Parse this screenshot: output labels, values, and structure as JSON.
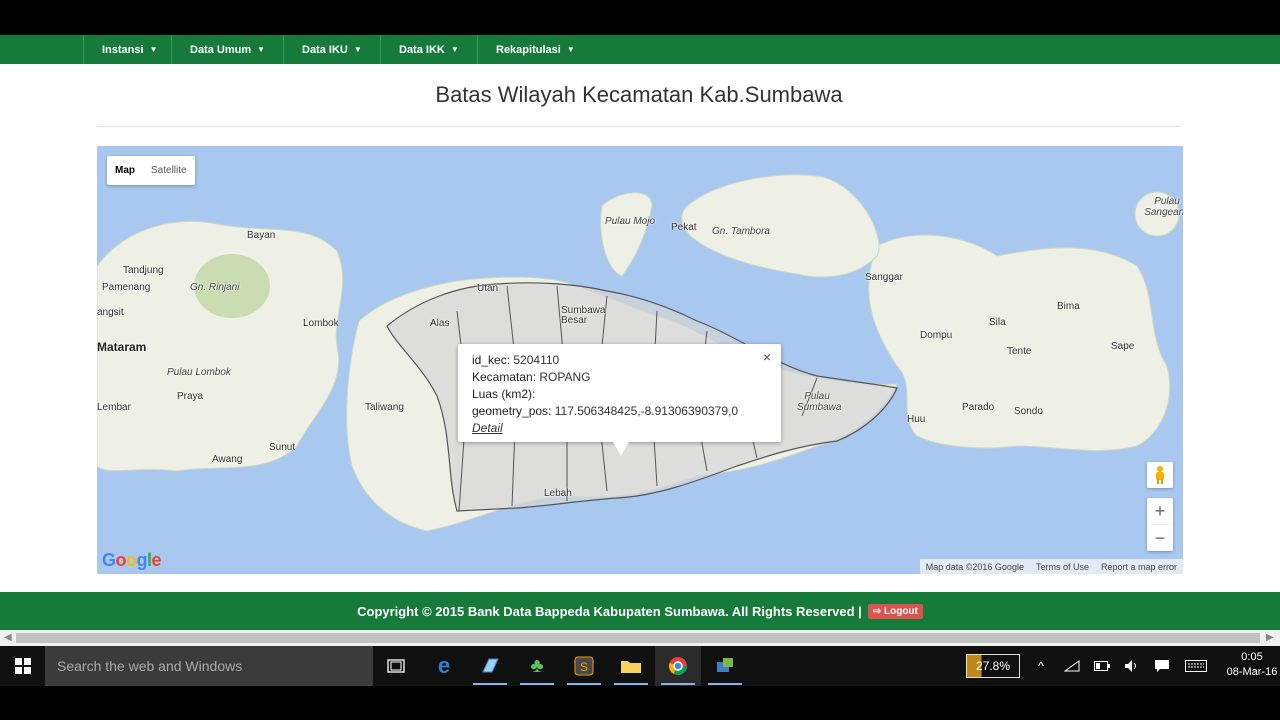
{
  "nav": {
    "items": [
      {
        "label": "Instansi"
      },
      {
        "label": "Data Umum"
      },
      {
        "label": "Data IKU"
      },
      {
        "label": "Data IKK"
      },
      {
        "label": "Rekapitulasi"
      }
    ]
  },
  "page": {
    "title": "Batas Wilayah Kecamatan Kab.Sumbawa"
  },
  "map": {
    "type_controls": {
      "map": "Map",
      "satellite": "Satellite"
    },
    "labels": {
      "bayan": "Bayan",
      "tandjung": "Tandjung",
      "pamenang": "Pamenang",
      "gn_rinjani": "Gn. Rinjani",
      "angsit": "angsit",
      "lombok": "Lombok",
      "mataram": "Mataram",
      "pulau_lombok": "Pulau Lombok",
      "praya": "Praya",
      "lembar": "Lembar",
      "sunut": "Sunut",
      "awang": "Awang",
      "pulau_mojo": "Pulau Mojo",
      "pekat": "Pekat",
      "gn_tambora": "Gn. Tambora",
      "pulau_sangeang": "Pulau Sangeang",
      "utan": "Utan",
      "sumbawa_besar": "Sumbawa Besar",
      "alas": "Alas",
      "taliwang": "Taliwang",
      "lebah": "Lebah",
      "pulau_sumbawa": "Pulau Sumbawa",
      "sanggar": "Sanggar",
      "dompu": "Dompu",
      "sila": "Sila",
      "bima": "Bima",
      "tente": "Tente",
      "sape": "Sape",
      "huu": "Huu",
      "parado": "Parado",
      "sondo": "Sondo"
    },
    "popup": {
      "id_kec_label": "id_kec:",
      "id_kec_value": "5204110",
      "kecamatan_label": "Kecamatan:",
      "kecamatan_value": "ROPANG",
      "luas_label": "Luas (km2):",
      "luas_value": "",
      "geometry_label": "geometry_pos:",
      "geometry_value": "117.506348425,-8.91306390379,0",
      "detail_link": "Detail",
      "close": "×"
    },
    "zoom": {
      "in": "+",
      "out": "−"
    },
    "logo": "Google",
    "attribution": {
      "data": "Map data ©2016 Google",
      "terms": "Terms of Use",
      "report": "Report a map error"
    },
    "colors": {
      "water": "#a8c8f0",
      "land": "#eef0e6",
      "region_fill": "#d6d6d6",
      "region_stroke": "#555555"
    }
  },
  "footer": {
    "copyright": "Copyright © 2015 Bank Data Bappeda Kabupaten Sumbawa. All Rights Reserved |",
    "logout": "Logout",
    "color": "#157a3a"
  },
  "taskbar": {
    "search_placeholder": "Search the web and Windows",
    "battery": "27.8%",
    "time": "0:05",
    "date": "08-Mar-16",
    "icons": [
      "windows-start-icon",
      "task-view-icon",
      "edge-icon",
      "app-icon",
      "clover-icon",
      "sublime-icon",
      "folder-icon",
      "chrome-icon",
      "network-tool-icon"
    ]
  }
}
